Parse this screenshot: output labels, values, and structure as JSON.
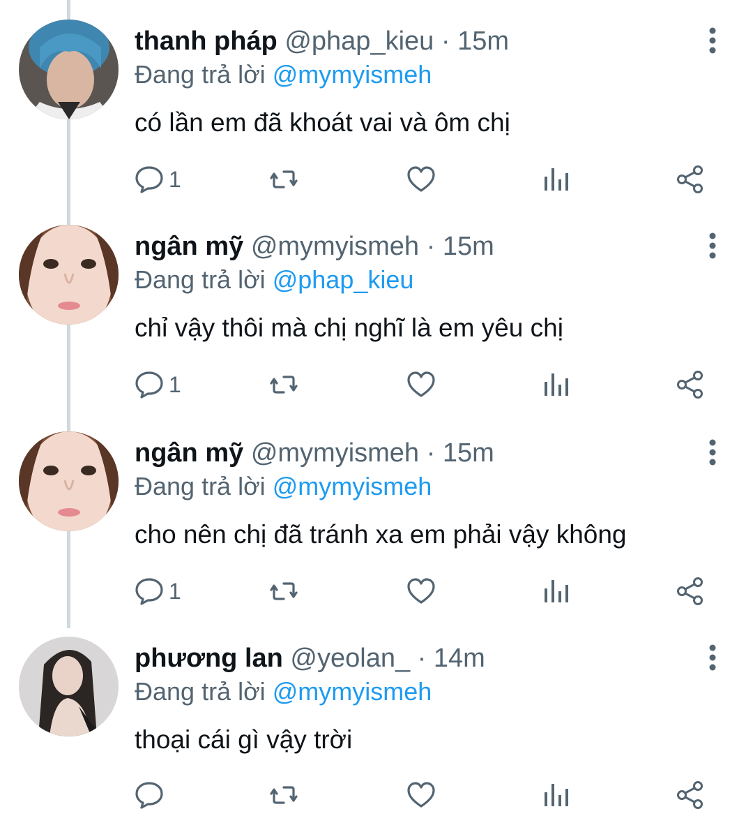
{
  "tweets": [
    {
      "name": "thanh pháp",
      "handle": "@phap_kieu",
      "separator": "·",
      "time": "15m",
      "reply_prefix": "Đang trả lời",
      "reply_to": "@mymyismeh",
      "text": "có lần em đã khoát vai và ôm chị",
      "reply_count": "1",
      "avatar_icon": "avatar-blue-hair"
    },
    {
      "name": "ngân mỹ",
      "handle": "@mymyismeh",
      "separator": "·",
      "time": "15m",
      "reply_prefix": "Đang trả lời",
      "reply_to": "@phap_kieu",
      "text": "chỉ vậy thôi mà chị nghĩ là em yêu chị",
      "reply_count": "1",
      "avatar_icon": "avatar-face-closeup"
    },
    {
      "name": "ngân mỹ",
      "handle": "@mymyismeh",
      "separator": "·",
      "time": "15m",
      "reply_prefix": "Đang trả lời",
      "reply_to": "@mymyismeh",
      "text": "cho nên chị đã tránh xa em phải vậy không",
      "reply_count": "1",
      "avatar_icon": "avatar-face-closeup"
    },
    {
      "name": "phương lan",
      "handle": "@yeolan_",
      "separator": "·",
      "time": "14m",
      "reply_prefix": "Đang trả lời",
      "reply_to": "@mymyismeh",
      "text": "thoại cái gì vậy trời",
      "reply_count": "",
      "avatar_icon": "avatar-long-hair"
    }
  ],
  "colors": {
    "text": "#0f1419",
    "secondary": "#536471",
    "mention": "#1d9bf0",
    "thread_line": "#cfd9de"
  }
}
